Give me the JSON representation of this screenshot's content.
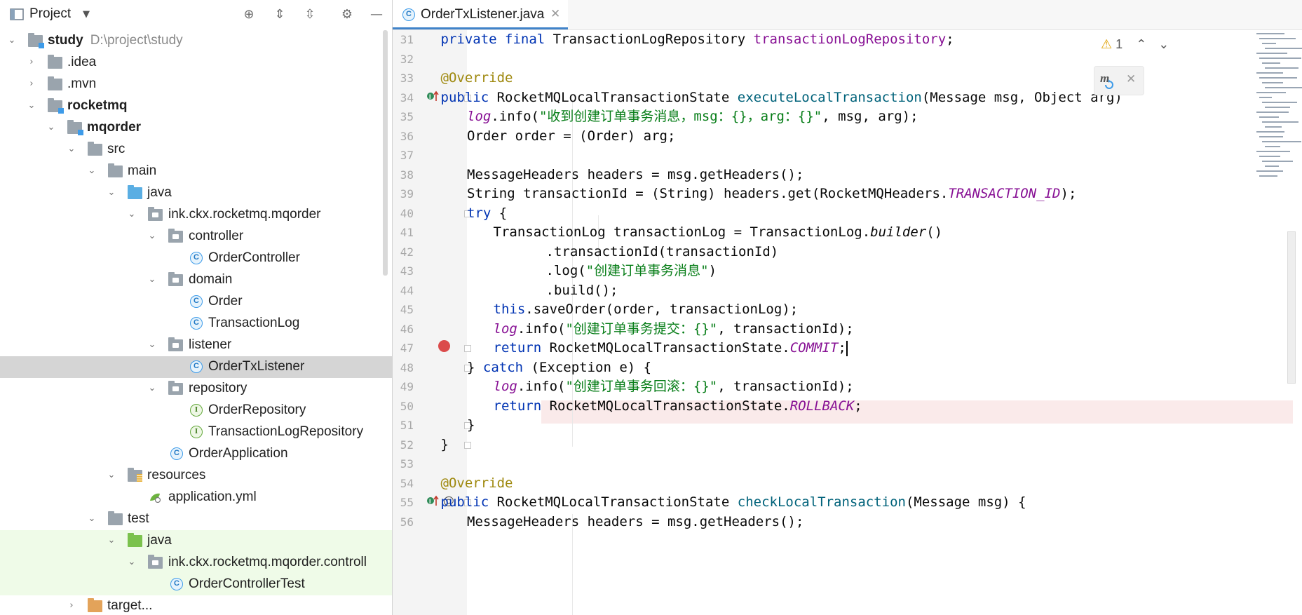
{
  "project_panel": {
    "title": "Project",
    "tree": [
      {
        "label": "study",
        "hint": "D:\\project\\study",
        "bold": true
      },
      {
        "label": ".idea"
      },
      {
        "label": ".mvn"
      },
      {
        "label": "rocketmq",
        "bold": true
      },
      {
        "label": "mqorder",
        "bold": true
      },
      {
        "label": "src"
      },
      {
        "label": "main"
      },
      {
        "label": "java"
      },
      {
        "label": "ink.ckx.rocketmq.mqorder"
      },
      {
        "label": "controller"
      },
      {
        "label": "OrderController"
      },
      {
        "label": "domain"
      },
      {
        "label": "Order"
      },
      {
        "label": "TransactionLog"
      },
      {
        "label": "listener"
      },
      {
        "label": "OrderTxListener"
      },
      {
        "label": "repository"
      },
      {
        "label": "OrderRepository"
      },
      {
        "label": "TransactionLogRepository"
      },
      {
        "label": "OrderApplication"
      },
      {
        "label": "resources"
      },
      {
        "label": "application.yml"
      },
      {
        "label": "test"
      },
      {
        "label": "java"
      },
      {
        "label": "ink.ckx.rocketmq.mqorder.controll"
      },
      {
        "label": "OrderControllerTest"
      },
      {
        "label": "target..."
      }
    ]
  },
  "editor": {
    "tab_label": "OrderTxListener.java",
    "inspection_count": "1",
    "line_numbers": [
      "31",
      "32",
      "33",
      "34",
      "35",
      "36",
      "37",
      "38",
      "39",
      "40",
      "41",
      "42",
      "43",
      "44",
      "45",
      "46",
      "47",
      "48",
      "49",
      "50",
      "51",
      "52",
      "53",
      "54",
      "55",
      "56"
    ],
    "code": {
      "l31_kw": "private final ",
      "l31_type": "TransactionLogRepository ",
      "l31_field": "transactionLogRepository",
      "l31_end": ";",
      "l33": "@Override",
      "l34_kw": "public ",
      "l34_type": "RocketMQLocalTransactionState ",
      "l34_method": "executeLocalTransaction",
      "l34_rest": "(Message msg, Object arg)",
      "l35_log": "log",
      "l35_a": ".info(",
      "l35_str": "\"收到创建订单事务消息，msg：{}，arg：{}\"",
      "l35_b": ", msg, arg);",
      "l36": "Order order = (Order) arg;",
      "l38": "MessageHeaders headers = msg.getHeaders();",
      "l39_a": "String transactionId = (String) headers.get(RocketMQHeaders.",
      "l39_const": "TRANSACTION_ID",
      "l39_b": ");",
      "l40_kw": "try",
      "l40_b": " {",
      "l41_a": "TransactionLog transactionLog = TransactionLog.",
      "l41_m": "builder",
      "l41_b": "()",
      "l42": ".transactionId(transactionId)",
      "l43_a": ".log(",
      "l43_str": "\"创建订单事务消息\"",
      "l43_b": ")",
      "l44": ".build();",
      "l45_kw": "this",
      "l45_b": ".saveOrder(order, transactionLog);",
      "l46_log": "log",
      "l46_a": ".info(",
      "l46_str": "\"创建订单事务提交：{}\"",
      "l46_b": ", transactionId);",
      "l47_kw": "return ",
      "l47_a": "RocketMQLocalTransactionState.",
      "l47_const": "COMMIT",
      "l47_b": ";",
      "l48_a": "} ",
      "l48_kw": "catch",
      "l48_b": " (Exception e) {",
      "l49_log": "log",
      "l49_a": ".info(",
      "l49_str": "\"创建订单事务回滚：{}\"",
      "l49_b": ", transactionId);",
      "l50_kw": "return ",
      "l50_a": "RocketMQLocalTransactionState.",
      "l50_const": "ROLLBACK",
      "l50_b": ";",
      "l51": "}",
      "l52": "}",
      "l54": "@Override",
      "l55_kw": "public ",
      "l55_type": "RocketMQLocalTransactionState ",
      "l55_method": "checkLocalTransaction",
      "l55_rest": "(Message msg) {",
      "l56": "MessageHeaders headers = msg.getHeaders();"
    }
  },
  "colors": {
    "keyword": "#0033b3",
    "annotation": "#9e880d",
    "field": "#871094",
    "method_decl": "#00627a",
    "string": "#067d17",
    "breakpoint": "#db4b4b",
    "selection": "#d5d5d5"
  },
  "icons": [
    "project-view-icon",
    "locate-icon",
    "expand-all-icon",
    "collapse-all-icon",
    "gear-icon",
    "minimize-icon",
    "close-icon",
    "warning-icon",
    "chevron-up-icon",
    "chevron-down-icon",
    "maven-reload-icon",
    "breakpoint-icon",
    "implements-icon"
  ]
}
